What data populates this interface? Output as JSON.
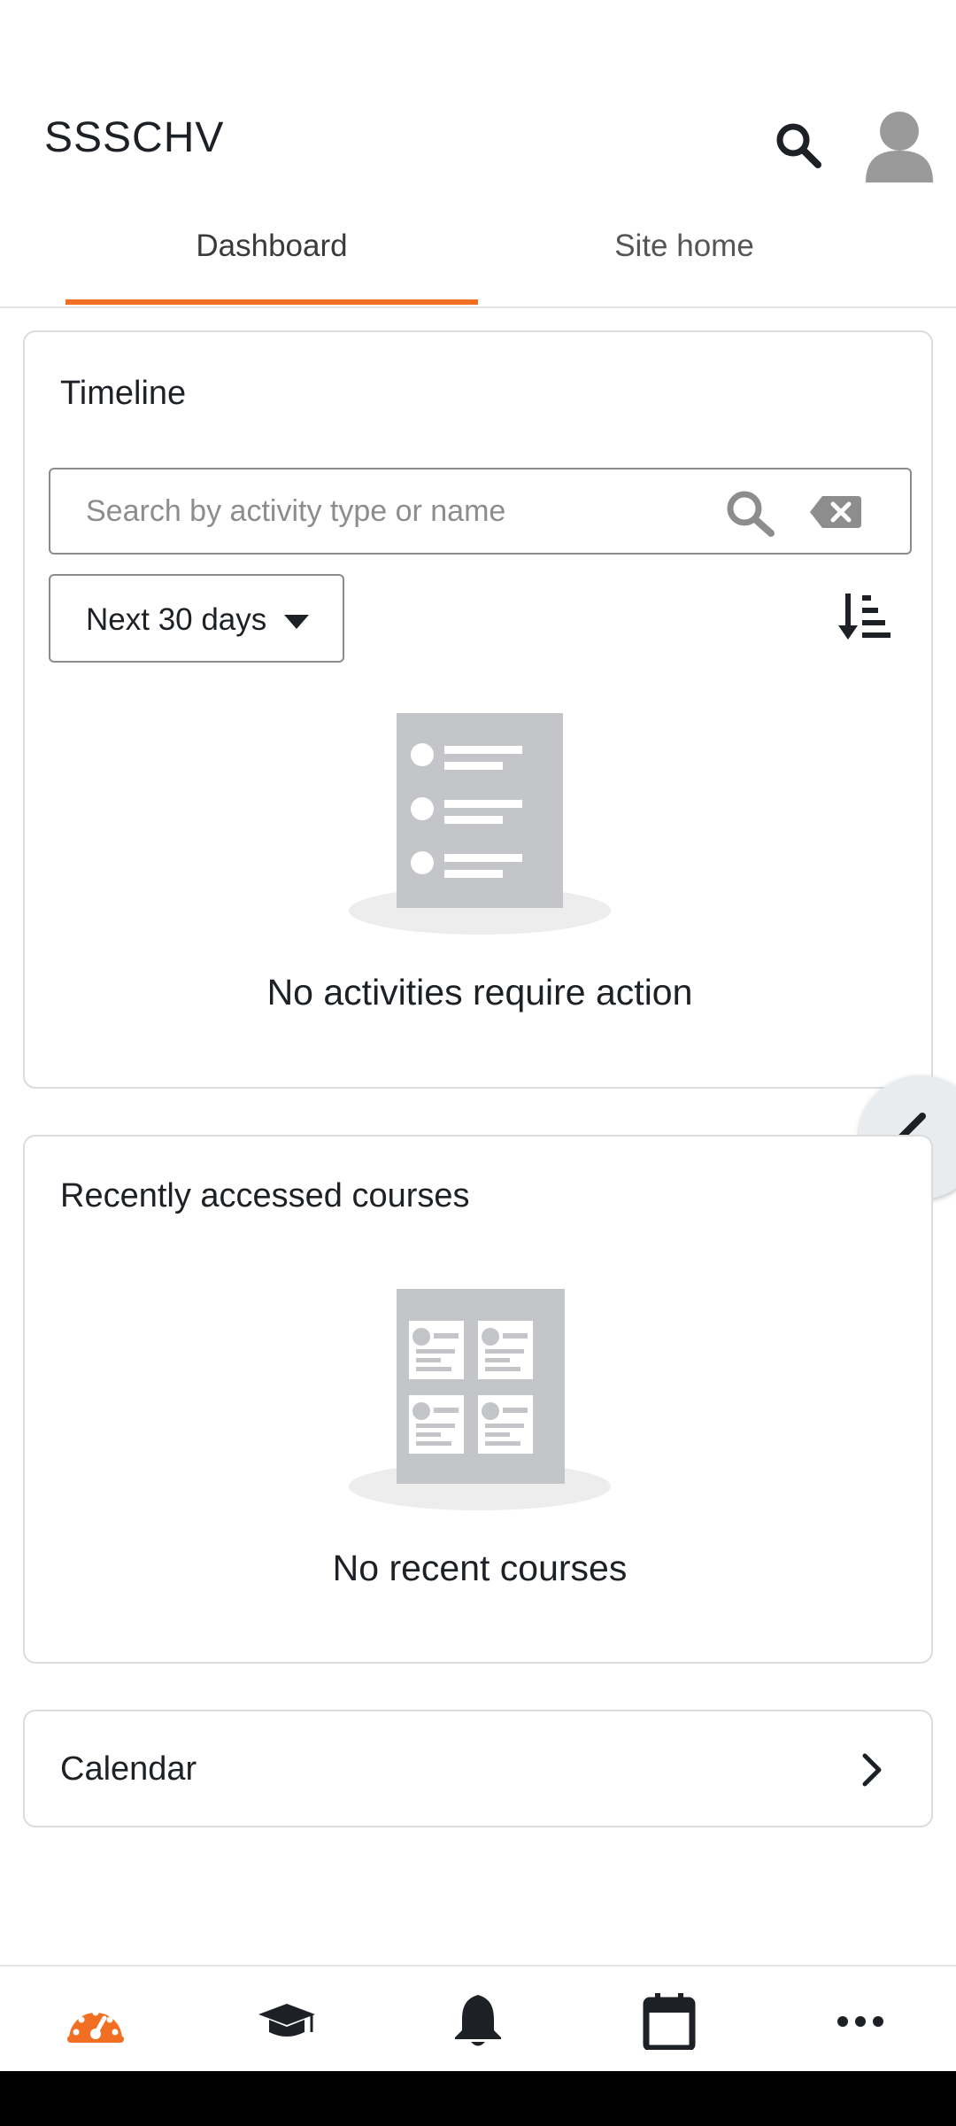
{
  "header": {
    "title": "SSSCHV"
  },
  "tabs": [
    {
      "label": "Dashboard",
      "active": true
    },
    {
      "label": "Site home",
      "active": false
    }
  ],
  "timeline": {
    "title": "Timeline",
    "search_placeholder": "Search by activity type or name",
    "filter_label": "Next 30 days",
    "empty_message": "No activities require action"
  },
  "recent_courses": {
    "title": "Recently accessed courses",
    "empty_message": "No recent courses"
  },
  "calendar": {
    "title": "Calendar"
  },
  "bottom_nav": {
    "items": [
      {
        "icon": "dashboard-icon",
        "active": true
      },
      {
        "icon": "courses-icon",
        "active": false
      },
      {
        "icon": "notifications-icon",
        "active": false
      },
      {
        "icon": "calendar-icon",
        "active": false
      },
      {
        "icon": "more-icon",
        "active": false
      }
    ]
  },
  "colors": {
    "accent": "#f16e22",
    "placeholder_gray": "#c3c5c9"
  }
}
